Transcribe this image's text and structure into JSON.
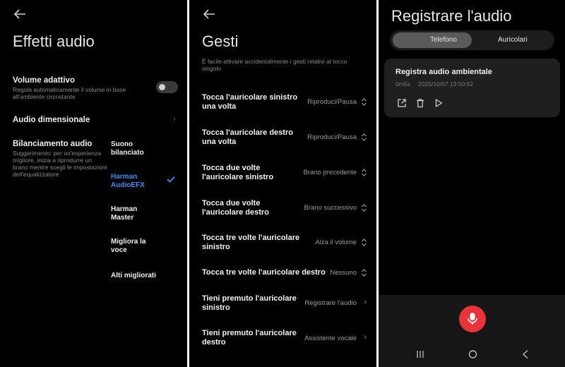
{
  "panel1": {
    "title": "Effetti audio",
    "volume": {
      "title": "Volume adattivo",
      "desc1": "Regola automaticamente il volume in base",
      "desc2": "all'ambiente circostante",
      "enabled": false
    },
    "dimensional": {
      "title": "Audio dimensionale"
    },
    "balance": {
      "title": "Bilanciamento audio",
      "desc": [
        "Suggerimento: per un'esperienza",
        "migliore, inizia a riprodurre un",
        "brano mentre scegli le impostazioni",
        "dell'equalizzatore"
      ],
      "options": [
        {
          "line1": "Suono",
          "line2": "bilanciato"
        },
        {
          "line1": "Harman",
          "line2": "AudioEFX",
          "selected": true
        },
        {
          "line1": "Harman",
          "line2": "Master"
        },
        {
          "line1": "Migliora la",
          "line2": "voce"
        },
        {
          "line1": "Alti migliorati",
          "line2": ""
        }
      ]
    }
  },
  "panel2": {
    "title": "Gesti",
    "subtitle1": "È facile attivare accidentalmente i gesti relativi al tocco",
    "subtitle2": "singolo",
    "gestures": [
      {
        "l1": "Tocca l'auricolare sinistro",
        "l2": "una volta",
        "value": "Riproduci/Pausa",
        "control": "updown"
      },
      {
        "l1": "Tocca l'auricolare destro",
        "l2": "una volta",
        "value": "Riproduci/Pausa",
        "control": "updown"
      },
      {
        "l1": "Tocca due volte",
        "l2": "l'auricolare sinistro",
        "value": "Brano precedente",
        "control": "updown"
      },
      {
        "l1": "Tocca due volte",
        "l2": "l'auricolare destro",
        "value": "Brano successivo",
        "control": "updown"
      },
      {
        "l1": "Tocca tre volte l'auricolare",
        "l2": "sinistro",
        "value": "Alza il volume",
        "control": "updown"
      },
      {
        "l1": "Tocca tre volte l'auricolare destro",
        "l2": "",
        "value": "Nessuno",
        "control": "updown"
      },
      {
        "l1": "Tieni premuto l'auricolare",
        "l2": "sinistro",
        "value": "Registrare l'audio",
        "control": "chevron"
      },
      {
        "l1": "Tieni premuto l'auricolare",
        "l2": "destro",
        "value": "Assistente vocale",
        "control": "chevron"
      }
    ]
  },
  "panel3": {
    "title": "Registrare l'audio",
    "tabs": [
      "Telefono",
      "Auricolari"
    ],
    "selected_tab": "Telefono",
    "recording": {
      "title": "Registra audio ambientale",
      "duration": "0m5s",
      "timestamp": "2025/10/07 13:50:52"
    },
    "icons": [
      "share-icon",
      "trash-icon",
      "play-icon",
      "microphone-icon"
    ],
    "accent": "#e8333a"
  },
  "colors": {
    "selection": "#3d8ef5",
    "background": "#000000"
  }
}
